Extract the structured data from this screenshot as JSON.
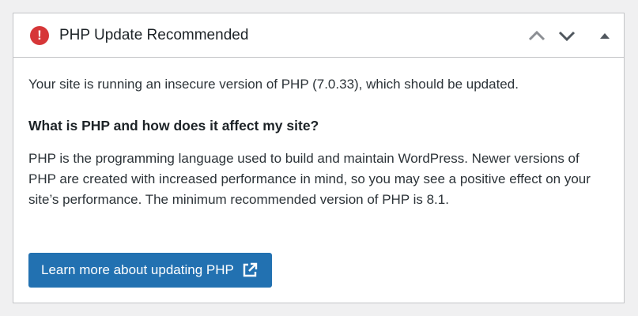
{
  "panel": {
    "title": "PHP Update Recommended",
    "alert_icon_glyph": "!",
    "controls": {
      "move_up": "chevron-up-icon",
      "move_down": "chevron-down-icon",
      "toggle": "triangle-up-icon"
    }
  },
  "content": {
    "intro": "Your site is running an insecure version of PHP (7.0.33), which should be updated.",
    "heading": "What is PHP and how does it affect my site?",
    "description": "PHP is the programming language used to build and maintain WordPress. Newer versions of PHP are created with increased performance in mind, so you may see a positive effect on your site’s performance. The minimum recommended version of PHP is 8.1.",
    "button_label": "Learn more about updating PHP"
  },
  "colors": {
    "accent": "#2271b1",
    "alert": "#d63638",
    "border": "#c3c4c7",
    "background": "#f0f0f1"
  }
}
